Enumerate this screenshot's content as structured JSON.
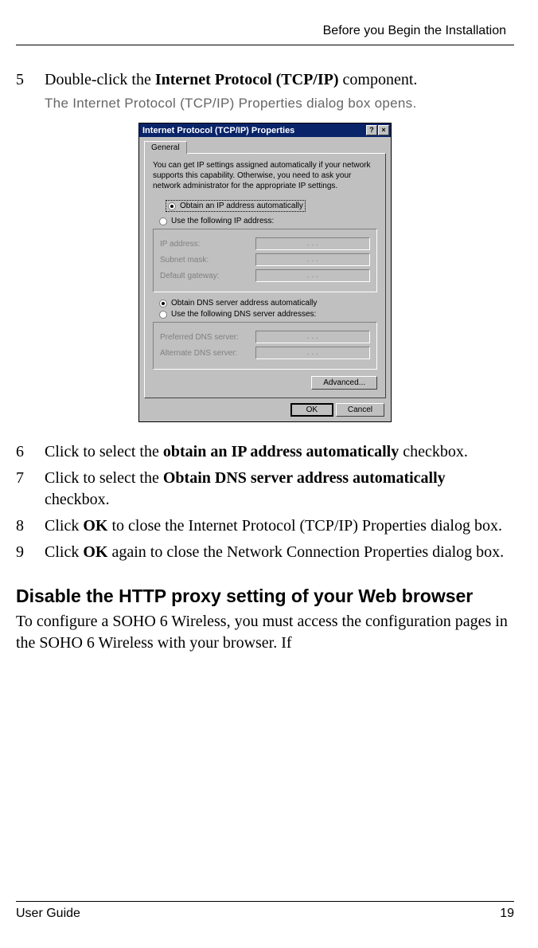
{
  "header": "Before you Begin the Installation",
  "steps": {
    "s5": {
      "num": "5",
      "text_before": "Double-click the ",
      "bold": "Internet Protocol (TCP/IP)",
      "text_after": " component."
    },
    "s5_note": "The Internet Protocol (TCP/IP) Properties dialog box opens.",
    "s6": {
      "num": "6",
      "a": "Click to select the ",
      "b": "obtain an IP address automatically",
      "c": " checkbox."
    },
    "s7": {
      "num": "7",
      "a": "Click to select the ",
      "b": "Obtain DNS server address automatically",
      "c": " checkbox."
    },
    "s8": {
      "num": "8",
      "a": "Click ",
      "b": "OK",
      "c": " to close the Internet Protocol (TCP/IP) Properties dialog box."
    },
    "s9": {
      "num": "9",
      "a": "Click ",
      "b": "OK",
      "c": " again to close the Network Connection Properties dialog box."
    }
  },
  "dialog": {
    "title": "Internet Protocol (TCP/IP) Properties",
    "help": "?",
    "close": "×",
    "tab": "General",
    "intro": "You can get IP settings assigned automatically if your network supports this capability. Otherwise, you need to ask your network administrator for the appropriate IP settings.",
    "r1": "Obtain an IP address automatically",
    "r2": "Use the following IP address:",
    "f_ip": "IP address:",
    "f_subnet": "Subnet mask:",
    "f_gateway": "Default gateway:",
    "ip_dots": ".       .       .",
    "r3": "Obtain DNS server address automatically",
    "r4": "Use the following DNS server addresses:",
    "f_pdns": "Preferred DNS server:",
    "f_adns": "Alternate DNS server:",
    "advanced": "Advanced...",
    "ok": "OK",
    "cancel": "Cancel"
  },
  "heading": "Disable the HTTP proxy setting of your Web browser",
  "body_para": "To configure a SOHO 6 Wireless, you must access the configuration pages in the SOHO 6 Wireless with your browser. If",
  "footer": {
    "left": "User Guide",
    "right": "19"
  }
}
